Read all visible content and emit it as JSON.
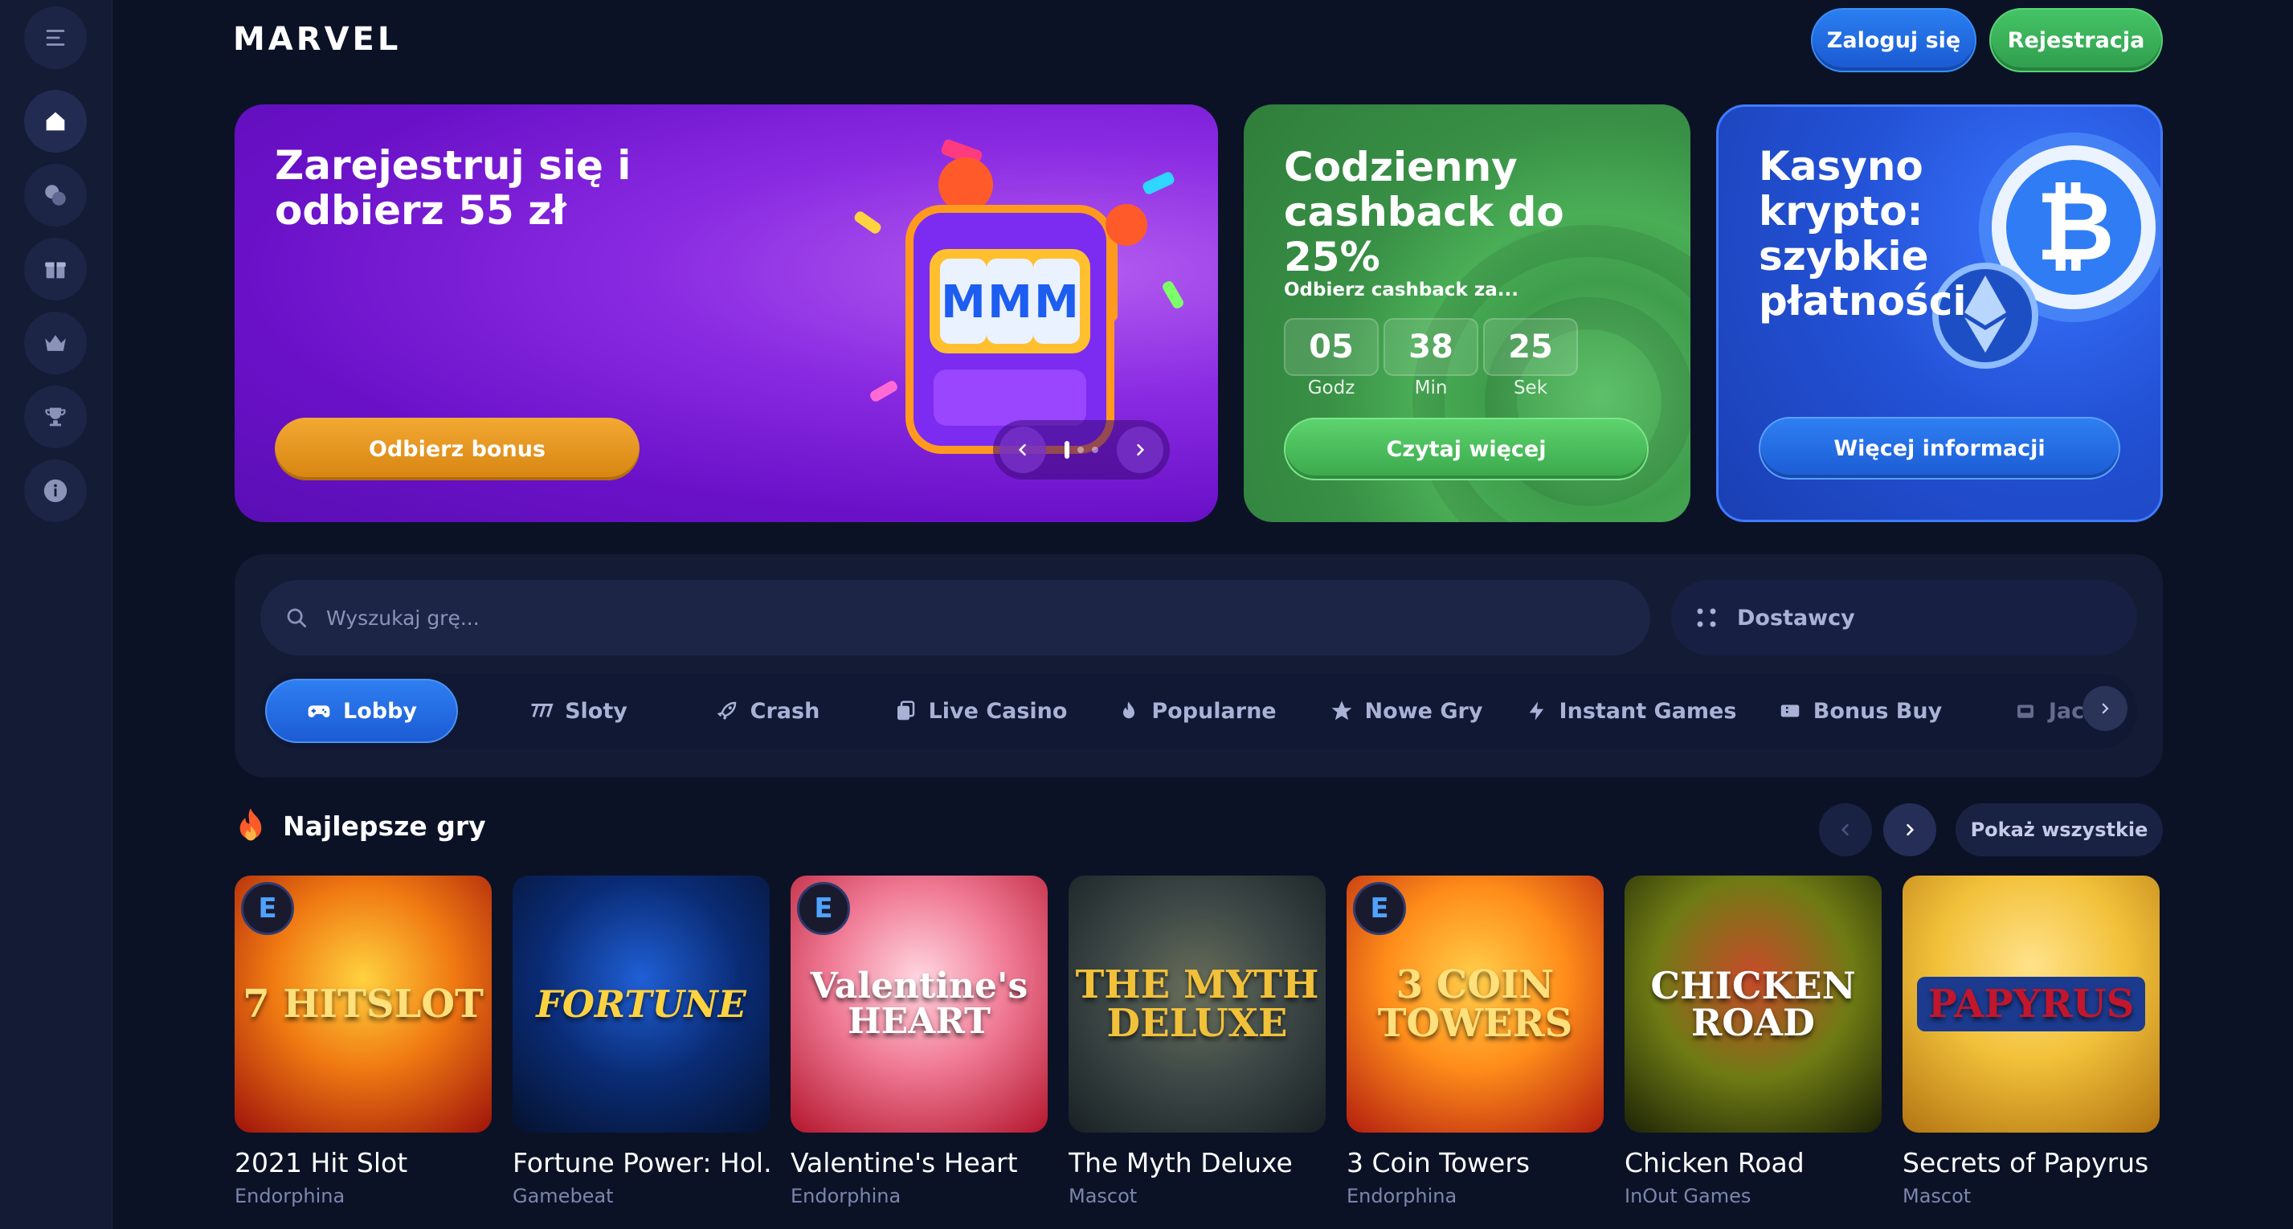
{
  "brand": {
    "logo": "MARVEL"
  },
  "header": {
    "login": "Zaloguj się",
    "register": "Rejestracja"
  },
  "sidebar": {
    "items": [
      {
        "icon": "menu-icon"
      },
      {
        "icon": "home-icon"
      },
      {
        "icon": "casino-chips-icon"
      },
      {
        "icon": "gift-icon"
      },
      {
        "icon": "crown-icon"
      },
      {
        "icon": "trophy-icon"
      },
      {
        "icon": "info-icon"
      }
    ]
  },
  "banners": {
    "promo": {
      "title": "Zarejestruj się i odbierz 55 zł",
      "button": "Odbierz bonus",
      "reels": [
        "M",
        "M",
        "M"
      ]
    },
    "cashback": {
      "title": "Codzienny cashback do 25%",
      "subtitle": "Odbierz cashback za...",
      "timer": [
        {
          "value": "05",
          "label": "Godz"
        },
        {
          "value": "38",
          "label": "Min"
        },
        {
          "value": "25",
          "label": "Sek"
        }
      ],
      "button": "Czytaj więcej"
    },
    "crypto": {
      "title": "Kasyno krypto: szybkie płatności",
      "button": "Więcej informacji"
    }
  },
  "search": {
    "placeholder": "Wyszukaj grę...",
    "providers": "Dostawcy"
  },
  "tabs": [
    "Lobby",
    "Sloty",
    "Crash",
    "Live Casino",
    "Popularne",
    "Nowe Gry",
    "Instant Games",
    "Bonus Buy",
    "Jac"
  ],
  "games_section": {
    "title": "Najlepsze gry",
    "show_all": "Pokaż wszystkie"
  },
  "games": [
    {
      "title": "2021 Hit Slot",
      "provider": "Endorphina",
      "art": "7 HITSLOT",
      "colors": [
        "#f6b21a",
        "#c0160d"
      ]
    },
    {
      "title": "Fortune Power: Hol...",
      "provider": "Gamebeat",
      "art": "FORTUNE",
      "colors": [
        "#0a2b74",
        "#05122e"
      ]
    },
    {
      "title": "Valentine's Heart",
      "provider": "Endorphina",
      "art": "Valentine's HEART",
      "colors": [
        "#f7b9c7",
        "#b3162d"
      ]
    },
    {
      "title": "The Myth Deluxe",
      "provider": "Mascot",
      "art": "THE MYTH DELUXE",
      "colors": [
        "#3f4a48",
        "#182024"
      ]
    },
    {
      "title": "3 Coin Towers",
      "provider": "Endorphina",
      "art": "3 COIN TOWERS",
      "colors": [
        "#ff8d1a",
        "#b31d0f"
      ]
    },
    {
      "title": "Chicken Road",
      "provider": "InOut Games",
      "art": "CHICKEN ROAD",
      "colors": [
        "#6e7b14",
        "#1d2206"
      ]
    },
    {
      "title": "Secrets of Papyrus",
      "provider": "Mascot",
      "art": "PAPYRUS",
      "colors": [
        "#f2c13a",
        "#b27412"
      ]
    }
  ]
}
